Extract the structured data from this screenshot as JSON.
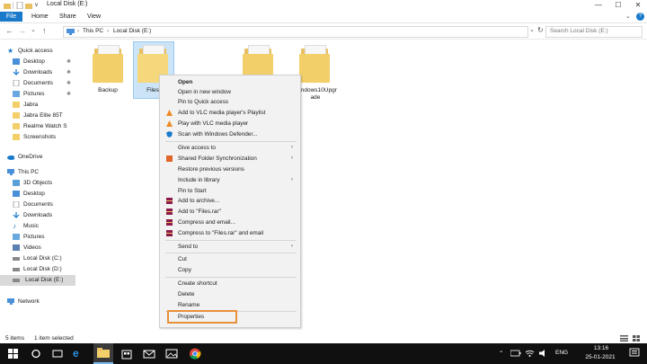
{
  "window": {
    "title": "Local Disk (E:)",
    "quick_access_arrow": "v",
    "minimize": "—",
    "maximize": "☐",
    "close": "✕"
  },
  "ribbon": {
    "tabs": [
      "File",
      "Home",
      "Share",
      "View"
    ],
    "expand": "⌄",
    "help": "?"
  },
  "address": {
    "back": "←",
    "forward": "→",
    "recent": "⌄",
    "up": "↑",
    "crumbs": [
      "This PC",
      "Local Disk (E:)"
    ],
    "dropdown": "⌄",
    "refresh": "↻",
    "search_placeholder": "Search Local Disk (E:)"
  },
  "nav": {
    "quick_access": "Quick access",
    "qa_items": [
      "Desktop",
      "Downloads",
      "Documents",
      "Pictures",
      "Jabra",
      "Jabra Elite 85T",
      "Realme Watch S",
      "Screenshots"
    ],
    "onedrive": "OneDrive",
    "this_pc": "This PC",
    "pc_items": [
      "3D Objects",
      "Desktop",
      "Documents",
      "Downloads",
      "Music",
      "Pictures",
      "Videos",
      "Local Disk (C:)",
      "Local Disk (D:)",
      "Local Disk (E:)"
    ],
    "network": "Network"
  },
  "folders": [
    {
      "label": "Backup"
    },
    {
      "label": "Files"
    },
    {
      "label": ""
    },
    {
      "label": ""
    },
    {
      "label": "Windows10Upgr\nade"
    }
  ],
  "context_menu": {
    "items": [
      "Open",
      "Open in new window",
      "Pin to Quick access",
      "Add to VLC media player's Playlist",
      "Play with VLC media player",
      "Scan with Windows Defender...",
      "Give access to",
      "Shared Folder Synchronization",
      "Restore previous versions",
      "Include in library",
      "Pin to Start",
      "Add to archive...",
      "Add to \"Files.rar\"",
      "Compress and email...",
      "Compress to \"Files.rar\" and email",
      "Send to",
      "Cut",
      "Copy",
      "Create shortcut",
      "Delete",
      "Rename",
      "Properties"
    ],
    "submenu_arrow": "›"
  },
  "status": {
    "count": "5 items",
    "selected": "1 item selected"
  },
  "taskbar": {
    "lang": "ENG",
    "time": "13:16",
    "date": "25-01-2021"
  },
  "colors": {
    "accent": "#1979ca",
    "highlight": "#e8903a",
    "folder": "#f3cf6a",
    "taskbar": "#101010"
  }
}
